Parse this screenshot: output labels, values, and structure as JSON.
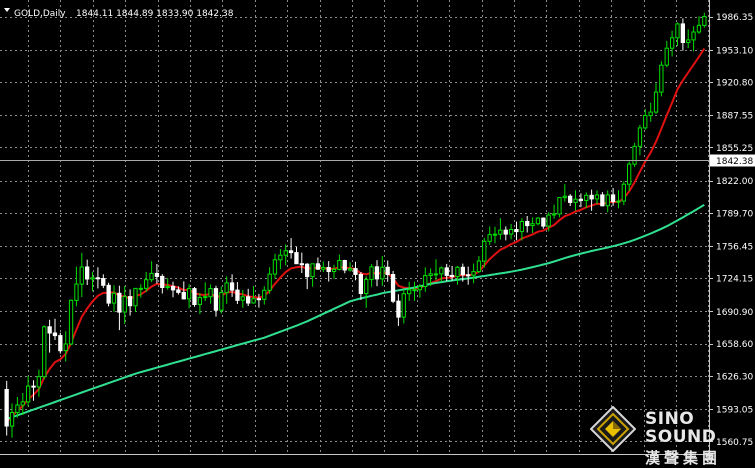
{
  "header": {
    "symbol": "GOLD,Daily",
    "ohlc": "1844.11 1844.89 1833.90 1842.38"
  },
  "colors": {
    "background": "#000000",
    "grid": "#8a8a8a",
    "bull": "#00e000",
    "bear": "#ffffff",
    "ma_fast": "#e01010",
    "ma_slow": "#30e090",
    "price_line": "#aaaaaa"
  },
  "logo": {
    "name_en": "SINO SOUND",
    "name_cn": "漢聲集團"
  },
  "chart_data": {
    "type": "candlestick",
    "title": "GOLD,Daily",
    "ylim": [
      1548.0,
      2003.0
    ],
    "y_ticks": [
      1986.35,
      1953.1,
      1920.8,
      1887.55,
      1855.25,
      1822.0,
      1789.7,
      1756.45,
      1724.15,
      1690.9,
      1658.6,
      1626.3,
      1593.05,
      1560.75
    ],
    "current_price_label": "1842.38",
    "grid": true,
    "candles": [
      [
        1612.6,
        1621.3,
        1566.4,
        1576.0
      ],
      [
        1576.0,
        1598.7,
        1564.2,
        1589.6
      ],
      [
        1589.6,
        1605.1,
        1584.3,
        1597.1
      ],
      [
        1597.1,
        1609.1,
        1587.1,
        1600.2
      ],
      [
        1600.2,
        1626.4,
        1595.7,
        1616.0
      ],
      [
        1616.0,
        1621.9,
        1601.3,
        1615.3
      ],
      [
        1615.3,
        1632.6,
        1605.3,
        1625.5
      ],
      [
        1625.5,
        1677.0,
        1622.7,
        1675.5
      ],
      [
        1675.5,
        1682.5,
        1649.6,
        1669.3
      ],
      [
        1669.3,
        1683.6,
        1662.3,
        1666.7
      ],
      [
        1666.7,
        1669.5,
        1648.6,
        1651.6
      ],
      [
        1651.6,
        1671.1,
        1640.6,
        1658.2
      ],
      [
        1658.2,
        1702.9,
        1657.0,
        1702.0
      ],
      [
        1702.0,
        1735.8,
        1696.1,
        1718.3
      ],
      [
        1718.3,
        1749.5,
        1705.3,
        1735.4
      ],
      [
        1735.4,
        1742.8,
        1717.4,
        1723.4
      ],
      [
        1723.4,
        1730.7,
        1711.2,
        1724.6
      ],
      [
        1724.6,
        1735.1,
        1714.0,
        1723.8
      ],
      [
        1723.8,
        1728.1,
        1714.3,
        1717.1
      ],
      [
        1717.1,
        1719.7,
        1695.9,
        1699.3
      ],
      [
        1699.3,
        1717.1,
        1690.5,
        1709.1
      ],
      [
        1709.1,
        1716.7,
        1672.2,
        1690.3
      ],
      [
        1690.3,
        1716.3,
        1678.3,
        1705.7
      ],
      [
        1705.7,
        1713.0,
        1686.7,
        1696.6
      ],
      [
        1696.6,
        1714.3,
        1690.3,
        1714.0
      ],
      [
        1714.0,
        1718.1,
        1704.7,
        1714.0
      ],
      [
        1714.0,
        1730.4,
        1710.3,
        1722.7
      ],
      [
        1722.7,
        1741.2,
        1720.3,
        1729.0
      ],
      [
        1729.0,
        1738.4,
        1718.8,
        1726.0
      ],
      [
        1726.0,
        1728.2,
        1708.9,
        1714.9
      ],
      [
        1714.9,
        1724.2,
        1712.7,
        1716.0
      ],
      [
        1716.0,
        1720.6,
        1705.1,
        1712.5
      ],
      [
        1712.5,
        1716.1,
        1707.9,
        1710.0
      ],
      [
        1710.0,
        1721.0,
        1702.9,
        1703.5
      ],
      [
        1703.5,
        1718.2,
        1693.9,
        1713.8
      ],
      [
        1713.8,
        1715.4,
        1695.5,
        1697.9
      ],
      [
        1697.9,
        1709.4,
        1688.3,
        1704.8
      ],
      [
        1704.8,
        1720.1,
        1701.2,
        1705.7
      ],
      [
        1705.7,
        1718.0,
        1698.6,
        1713.8
      ],
      [
        1713.8,
        1716.7,
        1685.7,
        1692.2
      ],
      [
        1692.2,
        1715.9,
        1688.8,
        1709.8
      ],
      [
        1709.8,
        1726.1,
        1698.4,
        1719.5
      ],
      [
        1719.5,
        1728.1,
        1705.4,
        1712.3
      ],
      [
        1712.3,
        1720.3,
        1698.3,
        1702.1
      ],
      [
        1702.1,
        1712.4,
        1694.5,
        1705.5
      ],
      [
        1705.5,
        1713.6,
        1696.2,
        1699.3
      ],
      [
        1699.3,
        1716.3,
        1698.6,
        1703.6
      ],
      [
        1703.6,
        1708.5,
        1694.7,
        1703.1
      ],
      [
        1703.1,
        1716.2,
        1697.8,
        1712.1
      ],
      [
        1712.1,
        1735.1,
        1708.5,
        1728.3
      ],
      [
        1728.3,
        1748.7,
        1723.6,
        1742.6
      ],
      [
        1742.6,
        1753.5,
        1733.3,
        1747.2
      ],
      [
        1747.2,
        1758.1,
        1737.0,
        1751.6
      ],
      [
        1751.6,
        1764.4,
        1743.8,
        1749.8
      ],
      [
        1749.8,
        1755.6,
        1738.7,
        1738.7
      ],
      [
        1738.7,
        1749.8,
        1729.4,
        1738.2
      ],
      [
        1738.2,
        1739.3,
        1713.3,
        1725.8
      ],
      [
        1725.8,
        1738.6,
        1715.7,
        1738.6
      ],
      [
        1738.6,
        1744.9,
        1732.4,
        1733.2
      ],
      [
        1733.2,
        1741.0,
        1730.4,
        1734.9
      ],
      [
        1734.9,
        1741.3,
        1720.9,
        1730.9
      ],
      [
        1730.9,
        1737.7,
        1723.5,
        1733.0
      ],
      [
        1733.0,
        1747.9,
        1732.0,
        1741.9
      ],
      [
        1741.9,
        1742.6,
        1729.1,
        1732.4
      ],
      [
        1732.4,
        1740.2,
        1730.8,
        1733.8
      ],
      [
        1733.8,
        1740.7,
        1722.1,
        1728.0
      ],
      [
        1728.0,
        1730.4,
        1702.4,
        1708.9
      ],
      [
        1708.9,
        1726.1,
        1694.4,
        1723.0
      ],
      [
        1723.0,
        1738.3,
        1715.6,
        1735.6
      ],
      [
        1735.6,
        1742.3,
        1716.1,
        1723.5
      ],
      [
        1723.5,
        1746.5,
        1716.5,
        1735.1
      ],
      [
        1735.1,
        1741.9,
        1720.6,
        1727.9
      ],
      [
        1727.9,
        1731.5,
        1699.2,
        1701.1
      ],
      [
        1701.1,
        1708.1,
        1676.4,
        1685.2
      ],
      [
        1685.2,
        1713.0,
        1678.8,
        1708.7
      ],
      [
        1708.7,
        1720.6,
        1701.4,
        1712.6
      ],
      [
        1712.6,
        1720.6,
        1701.4,
        1712.7
      ],
      [
        1712.7,
        1718.5,
        1704.6,
        1715.9
      ],
      [
        1715.9,
        1735.1,
        1710.6,
        1726.8
      ],
      [
        1726.8,
        1734.0,
        1716.3,
        1728.5
      ],
      [
        1728.5,
        1743.2,
        1722.1,
        1728.5
      ],
      [
        1728.5,
        1735.9,
        1720.6,
        1734.5
      ],
      [
        1734.5,
        1738.5,
        1721.4,
        1727.0
      ],
      [
        1727.0,
        1736.5,
        1721.6,
        1725.8
      ],
      [
        1725.8,
        1736.4,
        1717.6,
        1735.1
      ],
      [
        1735.1,
        1738.8,
        1720.8,
        1727.6
      ],
      [
        1727.6,
        1735.8,
        1717.7,
        1727.2
      ],
      [
        1727.2,
        1738.8,
        1719.2,
        1730.8
      ],
      [
        1730.8,
        1746.3,
        1729.5,
        1741.4
      ],
      [
        1741.4,
        1764.7,
        1734.6,
        1761.2
      ],
      [
        1761.2,
        1776.1,
        1757.6,
        1767.9
      ],
      [
        1767.9,
        1775.7,
        1759.1,
        1768.3
      ],
      [
        1768.3,
        1784.3,
        1762.9,
        1772.3
      ],
      [
        1772.3,
        1776.1,
        1762.1,
        1768.4
      ],
      [
        1768.4,
        1778.6,
        1763.1,
        1773.0
      ],
      [
        1773.0,
        1780.9,
        1762.2,
        1770.9
      ],
      [
        1770.9,
        1784.4,
        1762.1,
        1781.0
      ],
      [
        1781.0,
        1786.5,
        1770.0,
        1776.9
      ],
      [
        1776.9,
        1785.0,
        1769.6,
        1778.8
      ],
      [
        1778.8,
        1785.3,
        1777.0,
        1784.4
      ],
      [
        1784.4,
        1785.1,
        1773.7,
        1776.4
      ],
      [
        1776.4,
        1790.4,
        1771.2,
        1787.5
      ],
      [
        1787.5,
        1797.8,
        1783.8,
        1788.6
      ],
      [
        1788.6,
        1805.4,
        1785.1,
        1805.0
      ],
      [
        1805.0,
        1818.4,
        1801.0,
        1806.4
      ],
      [
        1806.4,
        1808.5,
        1796.4,
        1800.2
      ],
      [
        1800.2,
        1812.3,
        1791.9,
        1803.4
      ],
      [
        1803.4,
        1809.2,
        1795.3,
        1802.1
      ],
      [
        1802.1,
        1810.2,
        1794.5,
        1807.3
      ],
      [
        1807.3,
        1813.0,
        1791.7,
        1803.7
      ],
      [
        1803.7,
        1812.2,
        1798.5,
        1807.7
      ],
      [
        1807.7,
        1810.5,
        1796.2,
        1796.8
      ],
      [
        1796.8,
        1812.2,
        1790.2,
        1807.7
      ],
      [
        1807.7,
        1814.6,
        1796.7,
        1801.0
      ],
      [
        1801.0,
        1812.3,
        1794.3,
        1801.5
      ],
      [
        1801.5,
        1821.1,
        1797.3,
        1818.4
      ],
      [
        1818.4,
        1841.1,
        1811.6,
        1838.5
      ],
      [
        1838.5,
        1859.9,
        1835.5,
        1856.4
      ],
      [
        1856.4,
        1877.8,
        1847.3,
        1874.8
      ],
      [
        1874.8,
        1893.7,
        1873.0,
        1887.2
      ],
      [
        1887.2,
        1900.0,
        1880.9,
        1890.7
      ],
      [
        1890.7,
        1919.6,
        1888.8,
        1910.7
      ],
      [
        1910.7,
        1941.6,
        1906.4,
        1937.7
      ],
      [
        1937.7,
        1962.0,
        1935.7,
        1954.7
      ],
      [
        1954.7,
        1972.2,
        1946.4,
        1965.1
      ],
      [
        1965.1,
        1980.5,
        1956.9,
        1979.0
      ],
      [
        1979.0,
        1984.6,
        1952.2,
        1960.4
      ],
      [
        1960.4,
        1973.6,
        1954.8,
        1963.0
      ],
      [
        1963.0,
        1976.8,
        1951.6,
        1970.9
      ],
      [
        1970.9,
        1986.7,
        1969.0,
        1977.6
      ],
      [
        1977.6,
        1990.2,
        1975.3,
        1986.5
      ]
    ],
    "series": [
      {
        "values": [
          1580.0,
          1586.1,
          1591.3,
          1596.2,
          1602.7,
          1607.3,
          1613.0,
          1624.6,
          1633.2,
          1640.1,
          1642.9,
          1648.3,
          1659.2,
          1672.7,
          1685.5,
          1693.8,
          1700.9,
          1706.5,
          1709.5,
          1709.6,
          1710.1,
          1706.4,
          1706.0,
          1703.5,
          1706.2,
          1708.0,
          1711.6,
          1715.8,
          1718.6,
          1717.9,
          1717.5,
          1716.2,
          1714.8,
          1712.3,
          1712.8,
          1709.1,
          1707.9,
          1707.3,
          1708.7,
          1705.3,
          1706.5,
          1709.9,
          1710.6,
          1708.9,
          1708.1,
          1706.0,
          1705.3,
          1704.6,
          1706.5,
          1711.5,
          1718.7,
          1724.9,
          1730.4,
          1734.1,
          1735.1,
          1735.8,
          1733.4,
          1734.6,
          1734.3,
          1734.4,
          1733.6,
          1733.5,
          1735.2,
          1734.6,
          1734.4,
          1733.3,
          1729.0,
          1728.0,
          1729.8,
          1728.6,
          1729.7,
          1729.3,
          1724.1,
          1716.6,
          1714.8,
          1714.3,
          1714.0,
          1714.4,
          1717.0,
          1719.3,
          1721.2,
          1723.9,
          1724.6,
          1724.9,
          1727.0,
          1727.1,
          1727.1,
          1727.9,
          1730.8,
          1737.1,
          1743.3,
          1748.1,
          1752.7,
          1755.3,
          1758.4,
          1760.5,
          1764.0,
          1766.0,
          1768.1,
          1770.8,
          1771.9,
          1774.9,
          1777.5,
          1782.3,
          1786.3,
          1788.3,
          1790.9,
          1792.7,
          1795.3,
          1796.9,
          1798.9,
          1798.4,
          1800.4,
          1800.5,
          1800.7,
          1804.2,
          1811.3,
          1820.3,
          1830.9,
          1841.2,
          1850.2,
          1861.0,
          1874.0,
          1887.4,
          1900.1,
          1913.6,
          1922.5,
          1930.3,
          1938.2,
          1946.2,
          1954.3
        ]
      },
      {
        "values": [
          1583.0,
          1584.9,
          1586.8,
          1588.7,
          1590.6,
          1592.5,
          1594.4,
          1596.3,
          1598.2,
          1600.1,
          1602.0,
          1603.9,
          1605.8,
          1607.7,
          1609.6,
          1611.5,
          1613.4,
          1615.3,
          1617.2,
          1619.1,
          1621.0,
          1622.9,
          1624.8,
          1626.7,
          1628.5,
          1630.1,
          1631.6,
          1633.1,
          1634.6,
          1636.1,
          1637.6,
          1639.1,
          1640.6,
          1642.1,
          1643.6,
          1645.1,
          1646.6,
          1648.1,
          1649.6,
          1651.1,
          1652.6,
          1654.1,
          1655.6,
          1657.1,
          1658.6,
          1660.1,
          1661.6,
          1663.1,
          1664.6,
          1666.6,
          1668.6,
          1670.6,
          1672.6,
          1674.6,
          1676.6,
          1678.8,
          1681.0,
          1683.5,
          1686.0,
          1688.5,
          1691.0,
          1693.5,
          1696.0,
          1698.5,
          1701.0,
          1702.5,
          1703.9,
          1705.2,
          1706.5,
          1707.8,
          1709.2,
          1710.2,
          1711.2,
          1712.1,
          1713.0,
          1713.9,
          1714.9,
          1716.1,
          1717.3,
          1718.5,
          1719.5,
          1720.3,
          1721.1,
          1721.9,
          1722.6,
          1723.3,
          1724.0,
          1724.8,
          1725.6,
          1726.4,
          1727.3,
          1728.1,
          1729.0,
          1729.8,
          1730.7,
          1731.7,
          1732.8,
          1734.0,
          1735.3,
          1736.6,
          1737.9,
          1739.3,
          1740.9,
          1742.6,
          1744.3,
          1745.9,
          1747.4,
          1748.8,
          1750.1,
          1751.4,
          1752.6,
          1753.8,
          1755.0,
          1756.3,
          1757.7,
          1759.2,
          1760.8,
          1762.7,
          1764.7,
          1766.8,
          1769.0,
          1771.3,
          1773.7,
          1776.3,
          1779.1,
          1782.1,
          1785.1,
          1788.2,
          1791.3,
          1794.5,
          1797.7
        ]
      }
    ]
  }
}
